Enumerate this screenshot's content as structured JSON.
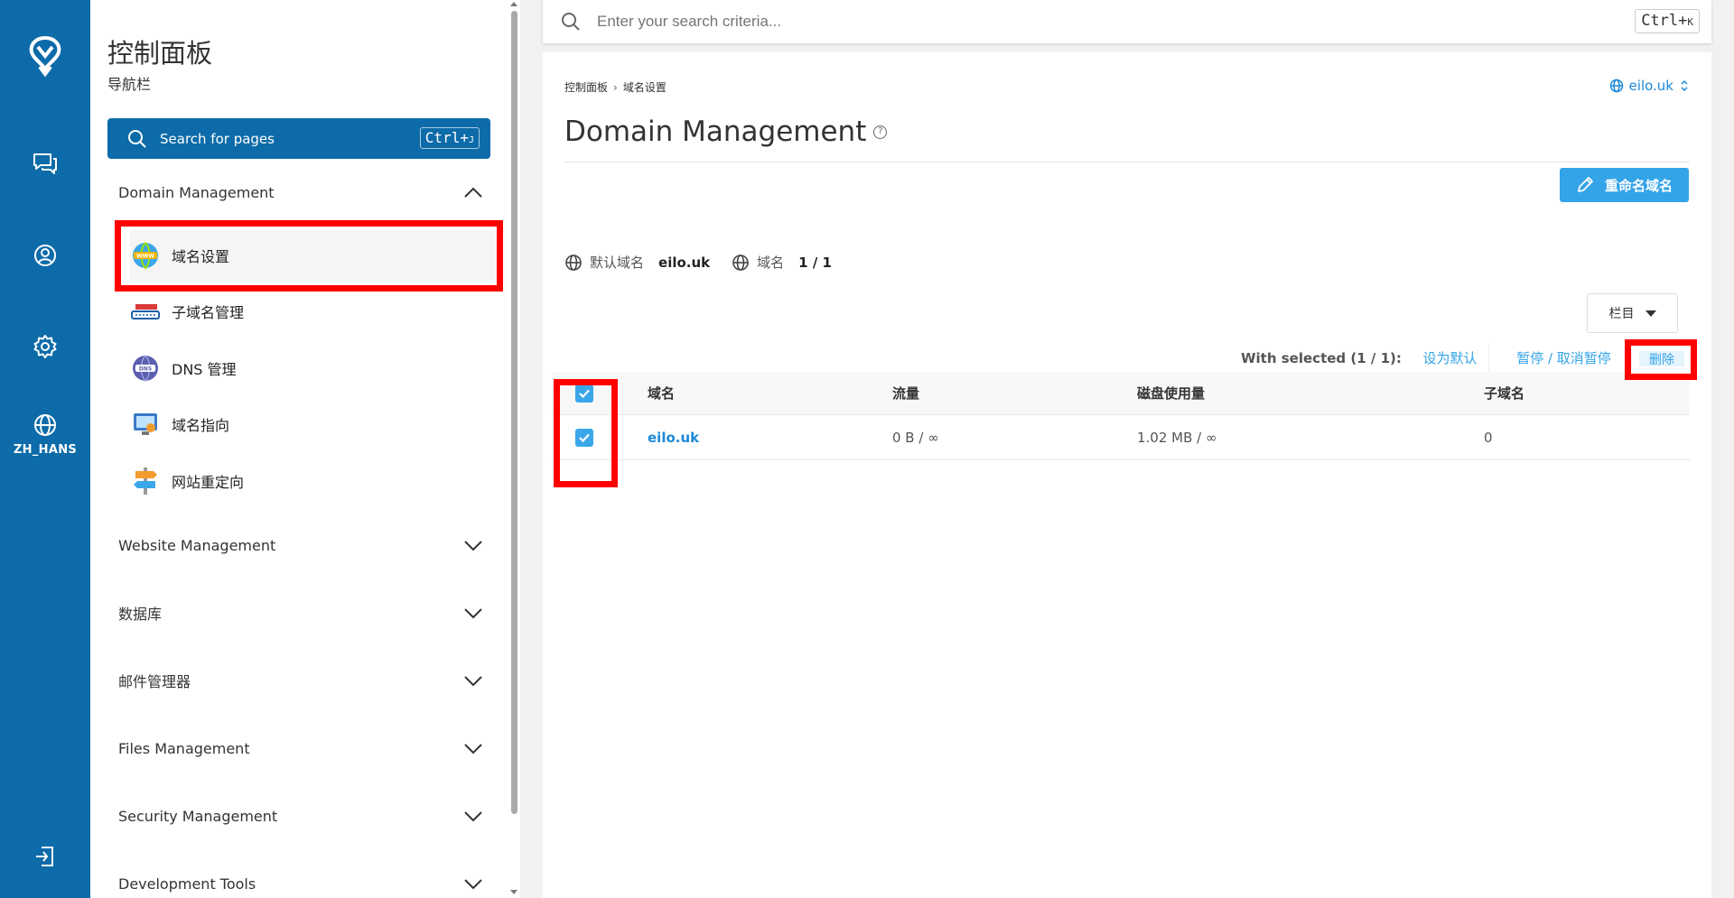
{
  "rail": {
    "lang": "ZH_HANS"
  },
  "sidebar": {
    "title": "控制面板",
    "subtitle": "导航栏",
    "search_label": "Search for pages",
    "search_kbd_main": "Ctrl+",
    "search_kbd_key": "J",
    "domain_section": "Domain Management",
    "items": [
      {
        "label": "域名设置",
        "icon": "www-globe-icon"
      },
      {
        "label": "子域名管理",
        "icon": "subdomain-icon"
      },
      {
        "label": "DNS 管理",
        "icon": "dns-icon"
      },
      {
        "label": "域名指向",
        "icon": "domain-pointer-icon"
      },
      {
        "label": "网站重定向",
        "icon": "signpost-icon"
      }
    ],
    "sections": [
      "Website Management",
      "数据库",
      "邮件管理器",
      "Files Management",
      "Security Management",
      "Development Tools"
    ]
  },
  "topbar": {
    "placeholder": "Enter your search criteria...",
    "kbd_main": "Ctrl+",
    "kbd_key": "K"
  },
  "main": {
    "breadcrumb": [
      "控制面板",
      "域名设置"
    ],
    "domain_switch": "eilo.uk",
    "title": "Domain Management",
    "rename_label": "重命名域名",
    "stats": {
      "default_label": "默认域名",
      "default_value": "eilo.uk",
      "count_label": "域名",
      "count_value": "1 / 1"
    },
    "columns_label": "栏目",
    "with_selected": "With selected (1 / 1):",
    "actions": [
      "设为默认",
      "暂停 / 取消暂停",
      "删除"
    ],
    "table": {
      "headers": [
        "域名",
        "流量",
        "磁盘使用量",
        "子域名"
      ],
      "rows": [
        {
          "domain": "eilo.uk",
          "traffic": "0 B / ∞",
          "disk": "1.02 MB / ∞",
          "subdomains": "0"
        }
      ]
    }
  },
  "colors": {
    "brand": "#0d6ba9",
    "accent": "#34a4e8",
    "highlight": "#ff0000"
  }
}
